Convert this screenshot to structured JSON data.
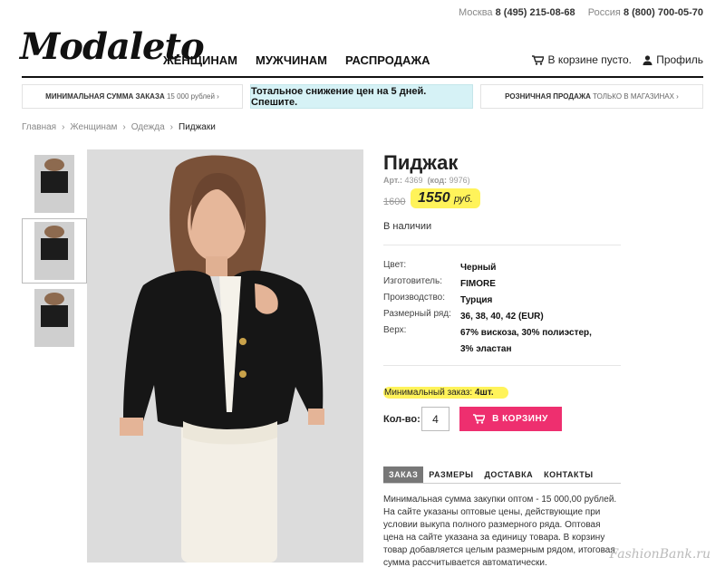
{
  "topbar": {
    "city1": "Москва",
    "phone1": "8 (495) 215-08-68",
    "city2": "Россия",
    "phone2": "8 (800) 700-05-70"
  },
  "header": {
    "logo": "Modaleto",
    "nav": [
      "ЖЕНЩИНАМ",
      "МУЖЧИНАМ",
      "РАСПРОДАЖА"
    ],
    "cart": "В корзине пусто.",
    "profile": "Профиль"
  },
  "promos": {
    "left_bold": "Минимальная сумма заказа",
    "left_rest": "15 000 рублей ›",
    "middle": "Тотальное снижение цен на 5 дней. Спешите.",
    "right_bold": "Розничная продажа",
    "right_rest": "только в магазинах ›"
  },
  "breadcrumbs": [
    "Главная",
    "Женщинам",
    "Одежда",
    "Пиджаки"
  ],
  "product": {
    "title": "Пиджак",
    "art_label": "Арт.:",
    "art": "4369",
    "code_label": "(код:",
    "code": "9976)",
    "old_price": "1600",
    "price": "1550",
    "currency": "руб.",
    "availability": "В наличии",
    "specs": [
      {
        "label": "Цвет:",
        "value": "Черный"
      },
      {
        "label": "Изготовитель:",
        "value": "FIMORE"
      },
      {
        "label": "Производство:",
        "value": "Турция"
      },
      {
        "label": "Размерный ряд:",
        "value": "36, 38, 40, 42 (EUR)"
      },
      {
        "label": "Верх:",
        "value": "67% вискоза, 30% полиэстер,",
        "value2": "3% эластан"
      }
    ],
    "min_order_label": "Минимальный заказ:",
    "min_order": "4шт.",
    "qty_label": "Кол-во:",
    "qty": "4",
    "buy_label": "В КОРЗИНУ"
  },
  "tabs": [
    "ЗАКАЗ",
    "РАЗМЕРЫ",
    "ДОСТАВКА",
    "КОНТАКТЫ"
  ],
  "description": "Минимальная сумма закупки оптом - 15 000,00 рублей. На сайте указаны оптовые цены, действующие при условии выкупа полного размерного ряда. Оптовая цена на сайте указана за единицу товара. В корзину товар добавляется целым размерным рядом, итоговая сумма рассчитывается автоматически.",
  "watermark": "FashionBank.ru",
  "colors": {
    "accent": "#ee2f6f",
    "highlight": "#fff35a",
    "promo_bg": "#d6f2f6"
  }
}
